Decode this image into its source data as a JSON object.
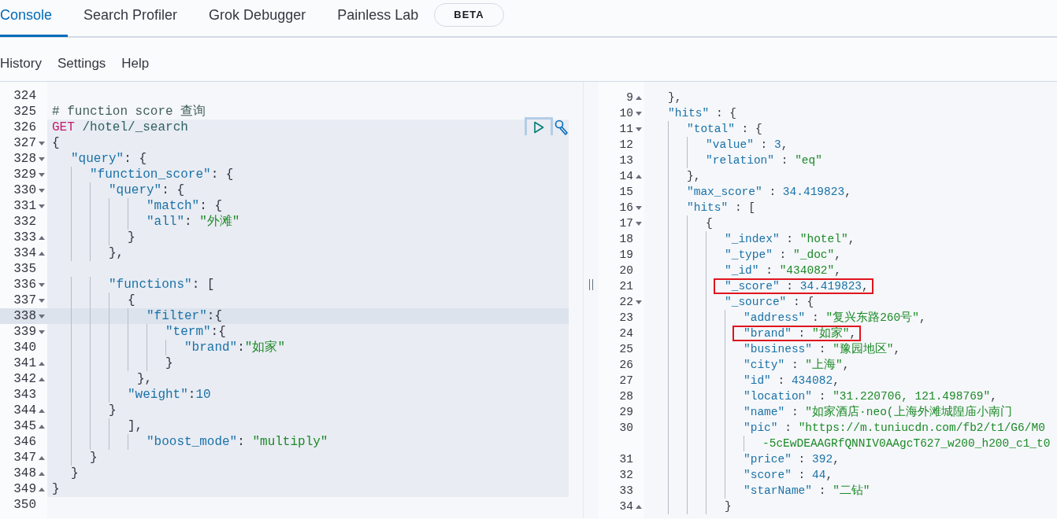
{
  "tabs": [
    {
      "label": "Console",
      "selected": true
    },
    {
      "label": "Search Profiler",
      "selected": false
    },
    {
      "label": "Grok Debugger",
      "selected": false
    },
    {
      "label": "Painless Lab",
      "selected": false,
      "badge": "BETA"
    }
  ],
  "menu": [
    "History",
    "Settings",
    "Help"
  ],
  "editor": {
    "lines": [
      {
        "number": "324",
        "kind": "json",
        "fold_start": false,
        "fold_end": false,
        "in_request": false,
        "active": false
      },
      {
        "number": "325",
        "kind": "comment",
        "text": "# function score 查询",
        "fold_start": false,
        "fold_end": false,
        "in_request": false,
        "active": false
      },
      {
        "number": "326",
        "kind": "request",
        "method": "GET",
        "path": "/hotel/_search",
        "fold_start": false,
        "fold_end": false,
        "in_request": true,
        "active": false
      },
      {
        "number": "327",
        "kind": "json",
        "text": "{",
        "fold_start": true,
        "fold_end": false,
        "in_request": true,
        "active": false
      },
      {
        "number": "328",
        "kind": "json",
        "text": "  \"query\": {",
        "fold_start": true,
        "fold_end": false,
        "in_request": true,
        "active": false
      },
      {
        "number": "329",
        "kind": "json",
        "text": "    \"function_score\": {",
        "fold_start": true,
        "fold_end": false,
        "in_request": true,
        "active": false
      },
      {
        "number": "330",
        "kind": "json",
        "text": "      \"query\": {",
        "fold_start": true,
        "fold_end": false,
        "in_request": true,
        "active": false
      },
      {
        "number": "331",
        "kind": "json",
        "text": "          \"match\": {",
        "fold_start": true,
        "fold_end": false,
        "in_request": true,
        "active": false
      },
      {
        "number": "332",
        "kind": "json",
        "text": "          \"all\": \"外滩\"",
        "fold_start": false,
        "fold_end": false,
        "in_request": true,
        "active": false
      },
      {
        "number": "333",
        "kind": "json",
        "text": "        }",
        "fold_start": false,
        "fold_end": true,
        "in_request": true,
        "active": false
      },
      {
        "number": "334",
        "kind": "json",
        "text": "      },",
        "fold_start": false,
        "fold_end": true,
        "in_request": true,
        "active": false
      },
      {
        "number": "335",
        "kind": "json",
        "fold_start": false,
        "fold_end": false,
        "in_request": true,
        "active": false
      },
      {
        "number": "336",
        "kind": "json",
        "text": "      \"functions\": [",
        "fold_start": true,
        "fold_end": false,
        "in_request": true,
        "active": false
      },
      {
        "number": "337",
        "kind": "json",
        "text": "        {",
        "fold_start": true,
        "fold_end": false,
        "in_request": true,
        "active": false
      },
      {
        "number": "338",
        "kind": "json",
        "text": "          \"filter\":{",
        "fold_start": true,
        "fold_end": false,
        "in_request": true,
        "active": true
      },
      {
        "number": "339",
        "kind": "json",
        "text": "            \"term\":{",
        "fold_start": true,
        "fold_end": false,
        "in_request": true,
        "active": false
      },
      {
        "number": "340",
        "kind": "json",
        "text": "              \"brand\":\"如家\"",
        "fold_start": false,
        "fold_end": false,
        "in_request": true,
        "active": false
      },
      {
        "number": "341",
        "kind": "json",
        "text": "            }",
        "fold_start": false,
        "fold_end": true,
        "in_request": true,
        "active": false
      },
      {
        "number": "342",
        "kind": "json",
        "text": "         },",
        "fold_start": false,
        "fold_end": true,
        "in_request": true,
        "active": false
      },
      {
        "number": "343",
        "kind": "json",
        "text": "        \"weight\":10",
        "fold_start": false,
        "fold_end": false,
        "in_request": true,
        "active": false
      },
      {
        "number": "344",
        "kind": "json",
        "text": "      }",
        "fold_start": false,
        "fold_end": true,
        "in_request": true,
        "active": false
      },
      {
        "number": "345",
        "kind": "json",
        "text": "        ],",
        "fold_start": false,
        "fold_end": true,
        "in_request": true,
        "active": false
      },
      {
        "number": "346",
        "kind": "json",
        "text": "          \"boost_mode\": \"multiply\"",
        "fold_start": false,
        "fold_end": false,
        "in_request": true,
        "active": false
      },
      {
        "number": "347",
        "kind": "json",
        "text": "    }",
        "fold_start": false,
        "fold_end": true,
        "in_request": true,
        "active": false
      },
      {
        "number": "348",
        "kind": "json",
        "text": "  }",
        "fold_start": false,
        "fold_end": true,
        "in_request": true,
        "active": false
      },
      {
        "number": "349",
        "kind": "json",
        "text": "}",
        "fold_start": false,
        "fold_end": true,
        "in_request": true,
        "active": false
      },
      {
        "number": "350",
        "kind": "json",
        "fold_start": false,
        "fold_end": false,
        "in_request": false,
        "active": false
      }
    ]
  },
  "output": {
    "lines": [
      {
        "number": "9",
        "text": "  },",
        "fold_start": false,
        "fold_end": true,
        "boxed": false
      },
      {
        "number": "10",
        "text": "  \"hits\" : {",
        "fold_start": true,
        "fold_end": false,
        "boxed": false
      },
      {
        "number": "11",
        "text": "    \"total\" : {",
        "fold_start": true,
        "fold_end": false,
        "boxed": false
      },
      {
        "number": "12",
        "text": "      \"value\" : 3,",
        "fold_start": false,
        "fold_end": false,
        "boxed": false
      },
      {
        "number": "13",
        "text": "      \"relation\" : \"eq\"",
        "fold_start": false,
        "fold_end": false,
        "boxed": false
      },
      {
        "number": "14",
        "text": "    },",
        "fold_start": false,
        "fold_end": true,
        "boxed": false
      },
      {
        "number": "15",
        "text": "    \"max_score\" : 34.419823,",
        "fold_start": false,
        "fold_end": false,
        "boxed": false
      },
      {
        "number": "16",
        "text": "    \"hits\" : [",
        "fold_start": true,
        "fold_end": false,
        "boxed": false
      },
      {
        "number": "17",
        "text": "      {",
        "fold_start": true,
        "fold_end": false,
        "boxed": false
      },
      {
        "number": "18",
        "text": "        \"_index\" : \"hotel\",",
        "fold_start": false,
        "fold_end": false,
        "boxed": false
      },
      {
        "number": "19",
        "text": "        \"_type\" : \"_doc\",",
        "fold_start": false,
        "fold_end": false,
        "boxed": false
      },
      {
        "number": "20",
        "text": "        \"_id\" : \"434082\",",
        "fold_start": false,
        "fold_end": false,
        "boxed": false
      },
      {
        "number": "21",
        "text": "        \"_score\" : 34.419823,",
        "fold_start": false,
        "fold_end": false,
        "boxed": true
      },
      {
        "number": "22",
        "text": "        \"_source\" : {",
        "fold_start": true,
        "fold_end": false,
        "boxed": false
      },
      {
        "number": "23",
        "text": "          \"address\" : \"复兴东路260号\",",
        "fold_start": false,
        "fold_end": false,
        "boxed": false
      },
      {
        "number": "24",
        "text": "          \"brand\" : \"如家\",",
        "fold_start": false,
        "fold_end": false,
        "boxed": true
      },
      {
        "number": "25",
        "text": "          \"business\" : \"豫园地区\",",
        "fold_start": false,
        "fold_end": false,
        "boxed": false
      },
      {
        "number": "26",
        "text": "          \"city\" : \"上海\",",
        "fold_start": false,
        "fold_end": false,
        "boxed": false
      },
      {
        "number": "27",
        "text": "          \"id\" : 434082,",
        "fold_start": false,
        "fold_end": false,
        "boxed": false
      },
      {
        "number": "28",
        "text": "          \"location\" : \"31.220706, 121.498769\",",
        "fold_start": false,
        "fold_end": false,
        "boxed": false
      },
      {
        "number": "29",
        "text": "          \"name\" : \"如家酒店·neo(上海外滩城隍庙小南门",
        "fold_start": false,
        "fold_end": false,
        "boxed": false
      },
      {
        "number": "30",
        "text": "          \"pic\" : \"https://m.tuniucdn.com/fb2/t1/G6/M0",
        "continuation": "            -5cEwDEAAGRfQNNIV0AAgcT627_w200_h200_c1_t0",
        "fold_start": false,
        "fold_end": false,
        "boxed": false
      },
      {
        "number": "31",
        "text": "          \"price\" : 392,",
        "fold_start": false,
        "fold_end": false,
        "boxed": false
      },
      {
        "number": "32",
        "text": "          \"score\" : 44,",
        "fold_start": false,
        "fold_end": false,
        "boxed": false
      },
      {
        "number": "33",
        "text": "          \"starName\" : \"二钻\"",
        "fold_start": false,
        "fold_end": false,
        "boxed": false
      },
      {
        "number": "34",
        "text": "        }",
        "fold_start": false,
        "fold_end": true,
        "boxed": false
      }
    ]
  }
}
